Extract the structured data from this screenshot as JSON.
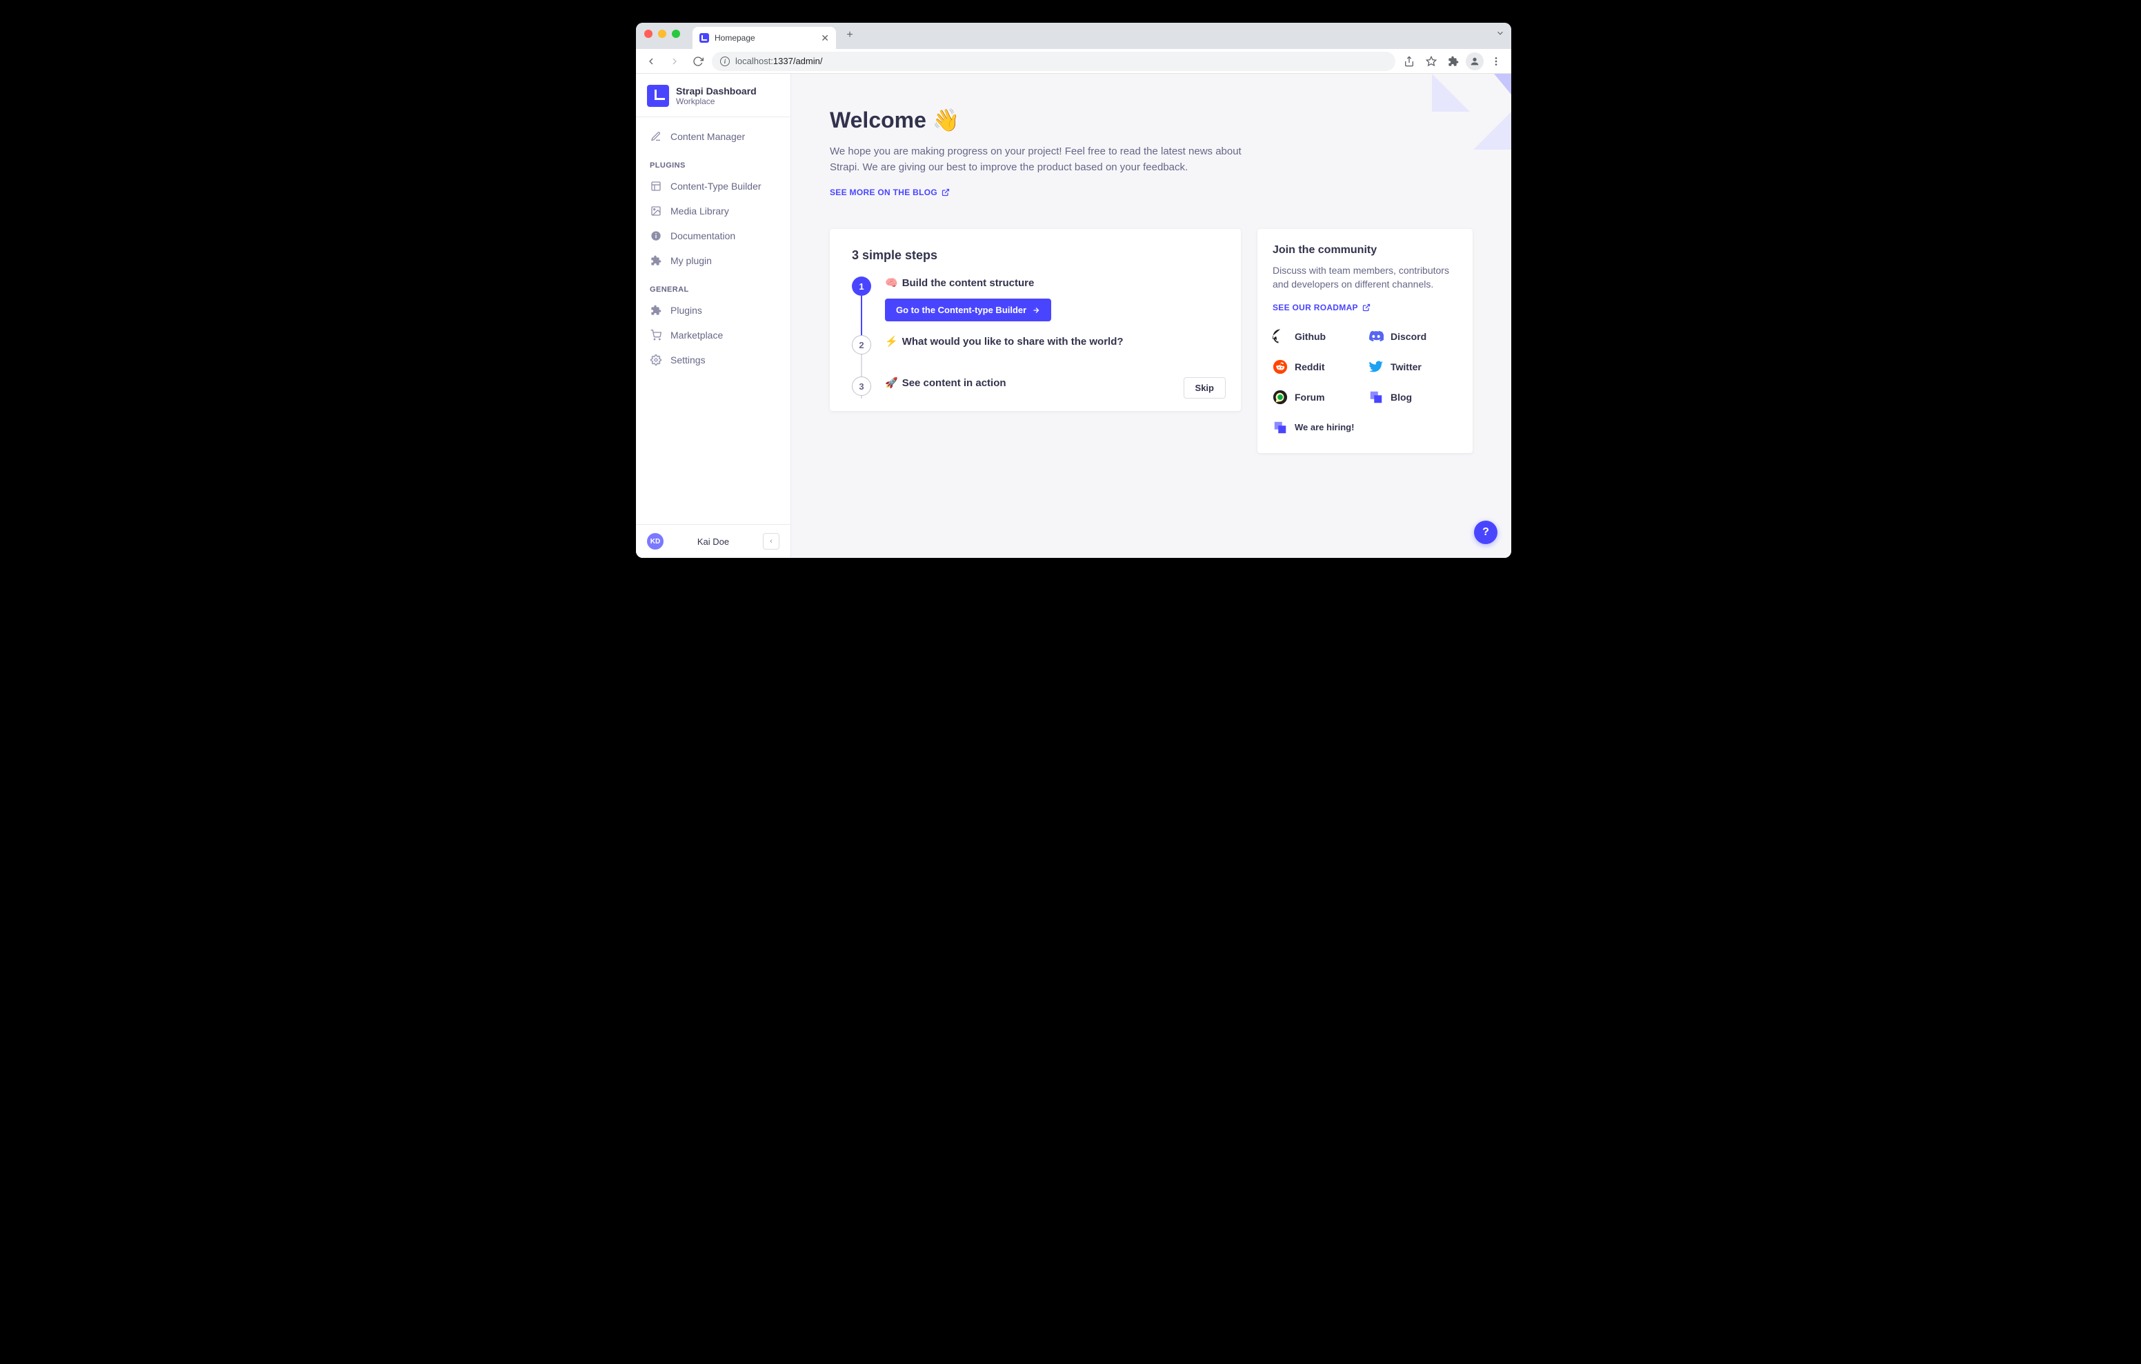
{
  "browser": {
    "tab_title": "Homepage",
    "url_host": "localhost:",
    "url_port_path": "1337/admin/"
  },
  "sidebar": {
    "title": "Strapi Dashboard",
    "subtitle": "Workplace",
    "content_manager": "Content Manager",
    "section_plugins": "PLUGINS",
    "items_plugins": [
      "Content-Type Builder",
      "Media Library",
      "Documentation",
      "My plugin"
    ],
    "section_general": "GENERAL",
    "items_general": [
      "Plugins",
      "Marketplace",
      "Settings"
    ],
    "user_initials": "KD",
    "user_name": "Kai Doe"
  },
  "hero": {
    "title": "Welcome 👋",
    "body": "We hope you are making progress on your project! Feel free to read the latest news about Strapi. We are giving our best to improve the product based on your feedback.",
    "blog_link": "SEE MORE ON THE BLOG"
  },
  "steps": {
    "heading": "3 simple steps",
    "items": [
      {
        "num": "1",
        "emoji": "🧠",
        "title": "Build the content structure"
      },
      {
        "num": "2",
        "emoji": "⚡",
        "title": "What would you like to share with the world?"
      },
      {
        "num": "3",
        "emoji": "🚀",
        "title": "See content in action"
      }
    ],
    "cta": "Go to the Content-type Builder",
    "skip": "Skip"
  },
  "community": {
    "heading": "Join the community",
    "body": "Discuss with team members, contributors and developers on different channels.",
    "roadmap": "SEE OUR ROADMAP",
    "links": [
      "Github",
      "Discord",
      "Reddit",
      "Twitter",
      "Forum",
      "Blog",
      "We are hiring!"
    ]
  },
  "help": "?"
}
